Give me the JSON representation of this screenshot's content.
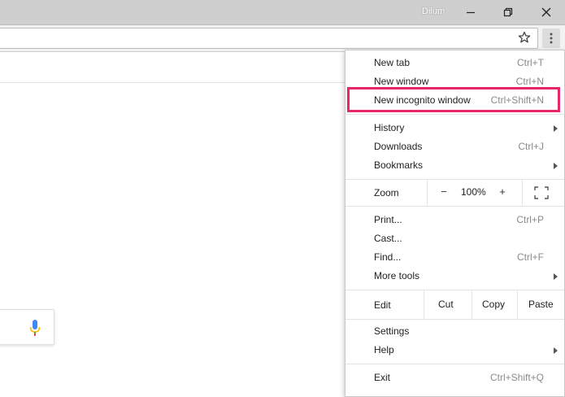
{
  "titlebar": {
    "user": "Dilum"
  },
  "menu": {
    "group1": [
      {
        "label": "New tab",
        "shortcut": "Ctrl+T"
      },
      {
        "label": "New window",
        "shortcut": "Ctrl+N"
      },
      {
        "label": "New incognito window",
        "shortcut": "Ctrl+Shift+N"
      }
    ],
    "group2": [
      {
        "label": "History",
        "shortcut": ""
      },
      {
        "label": "Downloads",
        "shortcut": "Ctrl+J"
      },
      {
        "label": "Bookmarks",
        "shortcut": ""
      }
    ],
    "zoom": {
      "label": "Zoom",
      "minus": "−",
      "value": "100%",
      "plus": "+"
    },
    "group3": [
      {
        "label": "Print...",
        "shortcut": "Ctrl+P"
      },
      {
        "label": "Cast...",
        "shortcut": ""
      },
      {
        "label": "Find...",
        "shortcut": "Ctrl+F"
      },
      {
        "label": "More tools",
        "shortcut": ""
      }
    ],
    "edit": {
      "label": "Edit",
      "cut": "Cut",
      "copy": "Copy",
      "paste": "Paste"
    },
    "group4": [
      {
        "label": "Settings",
        "shortcut": ""
      },
      {
        "label": "Help",
        "shortcut": ""
      }
    ],
    "exit": {
      "label": "Exit",
      "shortcut": "Ctrl+Shift+Q"
    }
  },
  "colors": {
    "highlight": "#e8266a",
    "titlebar": "#cfcfcf"
  },
  "icons": [
    "minimize-icon",
    "restore-icon",
    "close-icon",
    "star-icon",
    "kebab-menu-icon",
    "microphone-icon",
    "fullscreen-icon",
    "submenu-arrow-icon"
  ]
}
